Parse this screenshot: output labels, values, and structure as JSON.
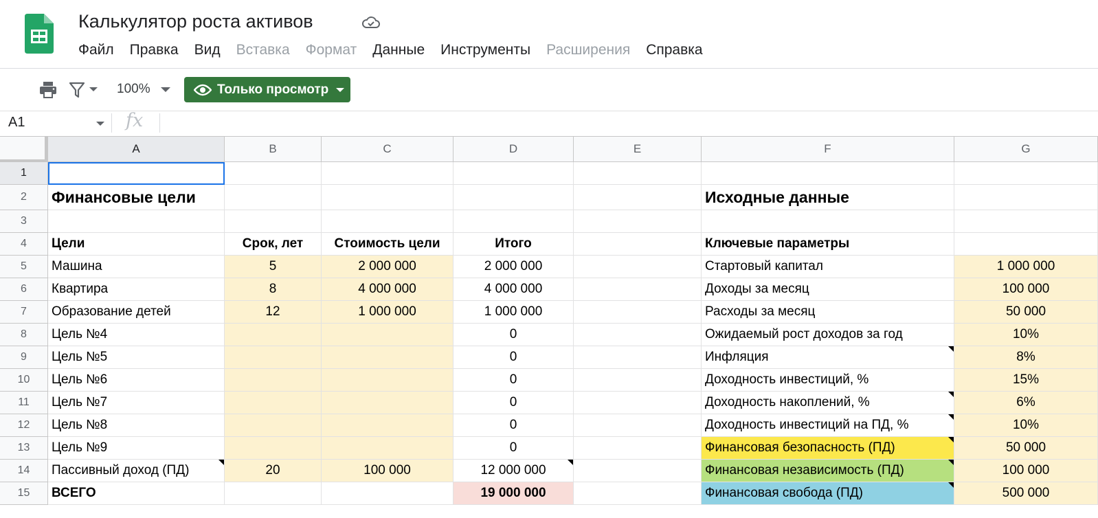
{
  "app": {
    "title": "Калькулятор роста активов"
  },
  "menu": [
    "Файл",
    "Правка",
    "Вид",
    "Вставка",
    "Формат",
    "Данные",
    "Инструменты",
    "Расширения",
    "Справка"
  ],
  "menu_disabled": [
    false,
    false,
    false,
    true,
    true,
    false,
    false,
    true,
    false
  ],
  "toolbar": {
    "zoom": "100%",
    "view_mode": "Только просмотр"
  },
  "formula_bar": {
    "cell_ref": "A1",
    "fx": "fx",
    "content": ""
  },
  "columns": [
    "A",
    "B",
    "C",
    "D",
    "E",
    "F",
    "G"
  ],
  "rows": [
    "1",
    "2",
    "3",
    "4",
    "5",
    "6",
    "7",
    "8",
    "9",
    "10",
    "11",
    "12",
    "13",
    "14",
    "15"
  ],
  "goals": {
    "title": "Финансовые цели",
    "headers": [
      "Цели",
      "Срок, лет",
      "Стоимость цели",
      "Итого"
    ],
    "items": [
      [
        "Машина",
        "5",
        "2 000 000",
        "2 000 000"
      ],
      [
        "Квартира",
        "8",
        "4 000 000",
        "4 000 000"
      ],
      [
        "Образование детей",
        "12",
        "1 000 000",
        "1 000 000"
      ],
      [
        "Цель №4",
        "",
        "",
        "0"
      ],
      [
        "Цель №5",
        "",
        "",
        "0"
      ],
      [
        "Цель №6",
        "",
        "",
        "0"
      ],
      [
        "Цель №7",
        "",
        "",
        "0"
      ],
      [
        "Цель №8",
        "",
        "",
        "0"
      ],
      [
        "Цель №9",
        "",
        "",
        "0"
      ],
      [
        "Пассивный доход (ПД)",
        "20",
        "100 000",
        "12 000 000"
      ]
    ],
    "total_label": "ВСЕГО",
    "total_value": "19 000 000"
  },
  "inputs": {
    "title": "Исходные данные",
    "subtitle": "Ключевые параметры",
    "items": [
      [
        "Стартовый капитал",
        "1 000 000"
      ],
      [
        "Доходы за месяц",
        "100 000"
      ],
      [
        "Расходы за месяц",
        "50 000"
      ],
      [
        "Ожидаемый рост доходов за год",
        "10%"
      ],
      [
        "Инфляция",
        "8%"
      ],
      [
        "Доходность инвестиций, %",
        "15%"
      ],
      [
        "Доходность накоплений, %",
        "6%"
      ],
      [
        "Доходность инвестиций на ПД, %",
        "10%"
      ],
      [
        "Финансовая безопасность (ПД)",
        "50 000"
      ],
      [
        "Финансовая независимость (ПД)",
        "100 000"
      ],
      [
        "Финансовая свобода (ПД)",
        "500 000"
      ]
    ]
  },
  "colors": {
    "input_fill": "#fdf2d0",
    "security": "#fce84c",
    "independence": "#b6e07f",
    "freedom": "#8fd1e3",
    "total_fill": "#f9ddd9",
    "view_button": "#34783c"
  }
}
